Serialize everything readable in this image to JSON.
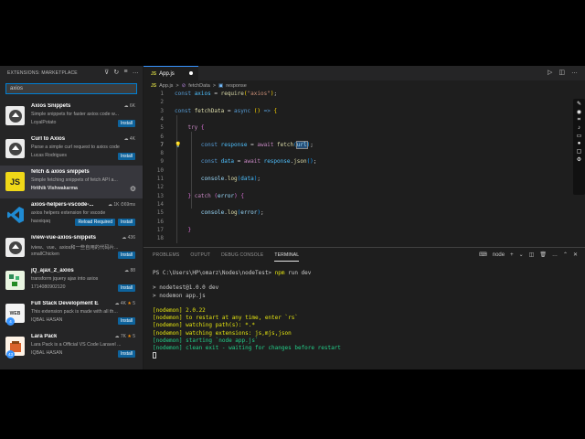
{
  "sidebar": {
    "title": "EXTENSIONS: MARKETPLACE",
    "search_value": "axios",
    "items": [
      {
        "name": "Axios Snippets",
        "desc": "Simple snippets for faster axios code w...",
        "publisher": "LoyalPotato",
        "stats": "6K",
        "button": "Install"
      },
      {
        "name": "Curl to Axios",
        "desc": "Parse a simple curl request to axios code",
        "publisher": "Lucas Rodrigues",
        "stats": "4K",
        "button": "Install"
      },
      {
        "name": "fetch & axios snippets",
        "desc": "Simple fetching snippets of fetch API a...",
        "publisher": "Hrithik Vishwakarma",
        "stats": "",
        "button": ""
      },
      {
        "name": "axios-helpers-vscode-...",
        "desc": "axios helpers extension for vscode",
        "publisher": "haoxiqaq",
        "stats": "1K  ⏱69ms",
        "button": "Install",
        "button2": "Reload Required"
      },
      {
        "name": "iview-vue-axios-snippets",
        "desc": "iview、vue、axios和一些自用的代码片...",
        "publisher": "smallChicken",
        "stats": "436",
        "button": "Install"
      },
      {
        "name": "jQ_ajax_2_axios",
        "desc": "transform jquery ajax into axios",
        "publisher": "1714080902120",
        "stats": "88",
        "button": "Install"
      },
      {
        "name": "Full Stack Development E...",
        "desc": "This extension pack is made with all th...",
        "publisher": "IQBAL HASAN",
        "stats": "4K",
        "rating": "5",
        "button": "Install",
        "badge": "4"
      },
      {
        "name": "Lara Pack",
        "desc": "Lara Pack is a Official VS Code Laravel ...",
        "publisher": "IQBAL HASAN",
        "stats": "7K",
        "rating": "5",
        "button": "Install",
        "badge": "43"
      }
    ]
  },
  "editor": {
    "tab": "App.js",
    "breadcrumb": [
      "App.js",
      ">",
      "fetchData",
      ">",
      "response"
    ],
    "lines": [
      "1",
      "2",
      "3",
      "4",
      "5",
      "6",
      "7",
      "8",
      "9",
      "10",
      "11",
      "12",
      "13",
      "14",
      "15",
      "16",
      "17",
      "18"
    ]
  },
  "panel": {
    "tabs": [
      "PROBLEMS",
      "OUTPUT",
      "DEBUG CONSOLE",
      "TERMINAL"
    ],
    "shell": "node",
    "terminal": [
      "PS C:\\Users\\HP\\omarz\\Nodes\\nodeTest> npm run dev",
      "",
      "> nodetest@1.0.0 dev",
      "> nodemon app.js",
      "",
      "[nodemon] 2.0.22",
      "[nodemon] to restart at any time, enter `rs`",
      "[nodemon] watching path(s): *.*",
      "[nodemon] watching extensions: js,mjs,json",
      "[nodemon] starting `node app.js`",
      "[nodemon] clean exit - waiting for changes before restart"
    ]
  },
  "colors": {
    "accent": "#0e639c",
    "editor_bg": "#1e1e1e",
    "sidebar_bg": "#252526"
  }
}
